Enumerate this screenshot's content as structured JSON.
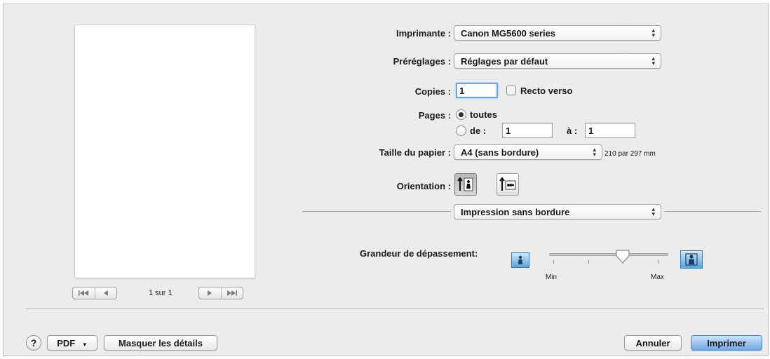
{
  "preview": {
    "page_count": "1 sur 1",
    "first_icon": "first-page-icon",
    "prev_icon": "previous-page-icon",
    "next_icon": "next-page-icon",
    "last_icon": "last-page-icon"
  },
  "printer": {
    "label": "Imprimante :",
    "value": "Canon MG5600 series"
  },
  "presets": {
    "label": "Préréglages :",
    "value": "Réglages par défaut"
  },
  "copies": {
    "label": "Copies :",
    "value": "1",
    "duplex_label": "Recto verso",
    "duplex_checked": false
  },
  "pages": {
    "label": "Pages :",
    "all_label": "toutes",
    "all_selected": true,
    "from_label": "de :",
    "from_value": "1",
    "to_label": "à :",
    "to_value": "1"
  },
  "paper_size": {
    "label": "Taille du papier :",
    "value": "A4 (sans bordure)",
    "dimensions": "210 par 297 mm"
  },
  "orientation": {
    "label": "Orientation :",
    "portrait_icon": "portrait-orientation-icon",
    "landscape_icon": "landscape-orientation-icon",
    "selected": "portrait"
  },
  "section": {
    "value": "Impression sans bordure"
  },
  "extension": {
    "label": "Grandeur de dépassement:",
    "min_label": "Min",
    "max_label": "Max",
    "level": 0.75,
    "min_icon": "small-extension-icon",
    "max_icon": "large-extension-icon"
  },
  "footer": {
    "help_label": "?",
    "pdf_label": "PDF",
    "details_label": "Masquer les détails",
    "cancel_label": "Annuler",
    "print_label": "Imprimer"
  },
  "colors": {
    "default_button": "#6fa7e8",
    "focus_ring": "#6fa0e6",
    "icon_blue": "#3778b5",
    "dialog_bg": "#ececec"
  }
}
